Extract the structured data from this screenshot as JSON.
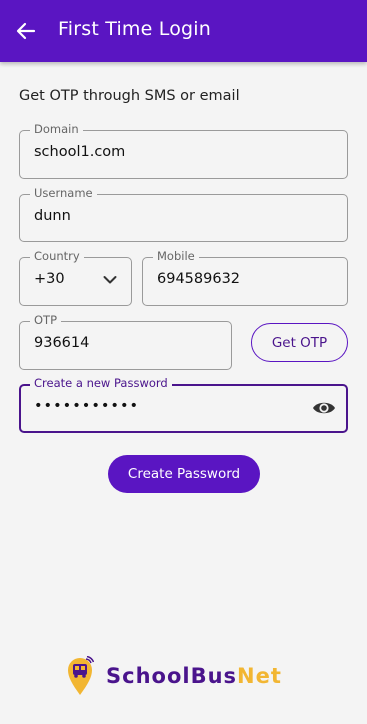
{
  "header": {
    "title": "First Time Login",
    "back_icon": "arrow-left-icon"
  },
  "subtitle": "Get OTP through SMS or email",
  "form": {
    "domain": {
      "label": "Domain",
      "value": "school1.com"
    },
    "username": {
      "label": "Username",
      "value": "dunn"
    },
    "country": {
      "label": "Country",
      "value": "+30"
    },
    "mobile": {
      "label": "Mobile",
      "value": "694589632"
    },
    "otp": {
      "label": "OTP",
      "value": "936614"
    },
    "password": {
      "label": "Create a new Password",
      "value": "•••••••••••",
      "icon": "eye-icon"
    }
  },
  "buttons": {
    "get_otp": "Get OTP",
    "create_password": "Create Password"
  },
  "brand": {
    "name_primary": "SchoolBus",
    "name_accent": "Net"
  },
  "colors": {
    "primary": "#5a15c2",
    "accent": "#f2b632",
    "focus": "#4a148c"
  }
}
